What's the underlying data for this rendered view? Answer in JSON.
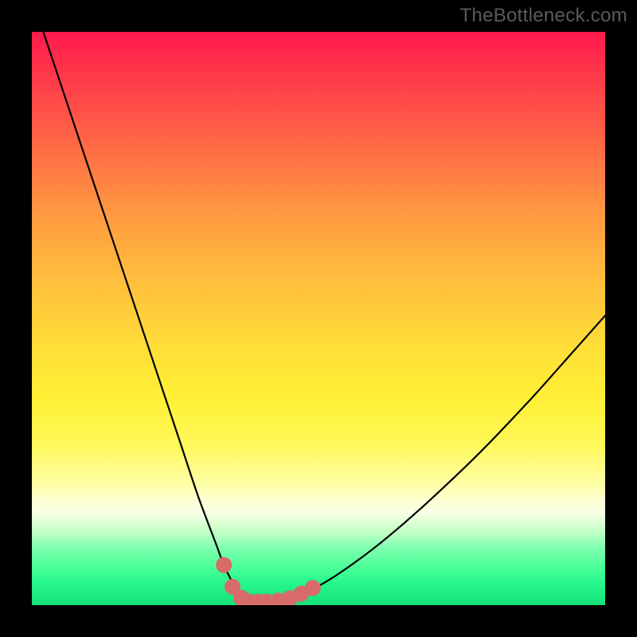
{
  "attribution": "TheBottleneck.com",
  "colors": {
    "background": "#000000",
    "curve": "#000000",
    "dots": "#d86a6a",
    "gradient_top": "#ff1a4d",
    "gradient_bottom": "#14e07a"
  },
  "chart_data": {
    "type": "line",
    "title": "",
    "xlabel": "",
    "ylabel": "",
    "xlim": [
      0,
      100
    ],
    "ylim": [
      0,
      100
    ],
    "grid": false,
    "annotations": [],
    "series": [
      {
        "name": "bottleneck-curve",
        "x": [
          2,
          5,
          8,
          11,
          14,
          17,
          20,
          23,
          26,
          29,
          32,
          33.5,
          35,
          36.5,
          38,
          39.5,
          41,
          43,
          45,
          48,
          52,
          56,
          60,
          64,
          68,
          72,
          76,
          80,
          84,
          88,
          92,
          96,
          100
        ],
        "y": [
          100,
          91,
          82,
          73,
          64,
          55,
          46,
          37,
          28,
          19,
          11,
          7,
          4,
          2,
          1,
          0.6,
          0.6,
          0.8,
          1.2,
          2.3,
          4.5,
          7.2,
          10.2,
          13.5,
          17,
          20.7,
          24.5,
          28.5,
          32.7,
          37,
          41.5,
          46,
          50.5
        ]
      }
    ],
    "markers": [
      {
        "name": "dot-1",
        "x": 33.5,
        "y": 7
      },
      {
        "name": "dot-2",
        "x": 35.0,
        "y": 3.2
      },
      {
        "name": "dot-3",
        "x": 36.5,
        "y": 1.3
      },
      {
        "name": "dot-4",
        "x": 38.0,
        "y": 0.6
      },
      {
        "name": "dot-5",
        "x": 39.5,
        "y": 0.6
      },
      {
        "name": "dot-6",
        "x": 41.0,
        "y": 0.6
      },
      {
        "name": "dot-7",
        "x": 43.0,
        "y": 0.8
      },
      {
        "name": "dot-8",
        "x": 45.0,
        "y": 1.2
      },
      {
        "name": "dot-9",
        "x": 47.0,
        "y": 2.0
      },
      {
        "name": "dot-10",
        "x": 49.0,
        "y": 3.0
      }
    ]
  }
}
